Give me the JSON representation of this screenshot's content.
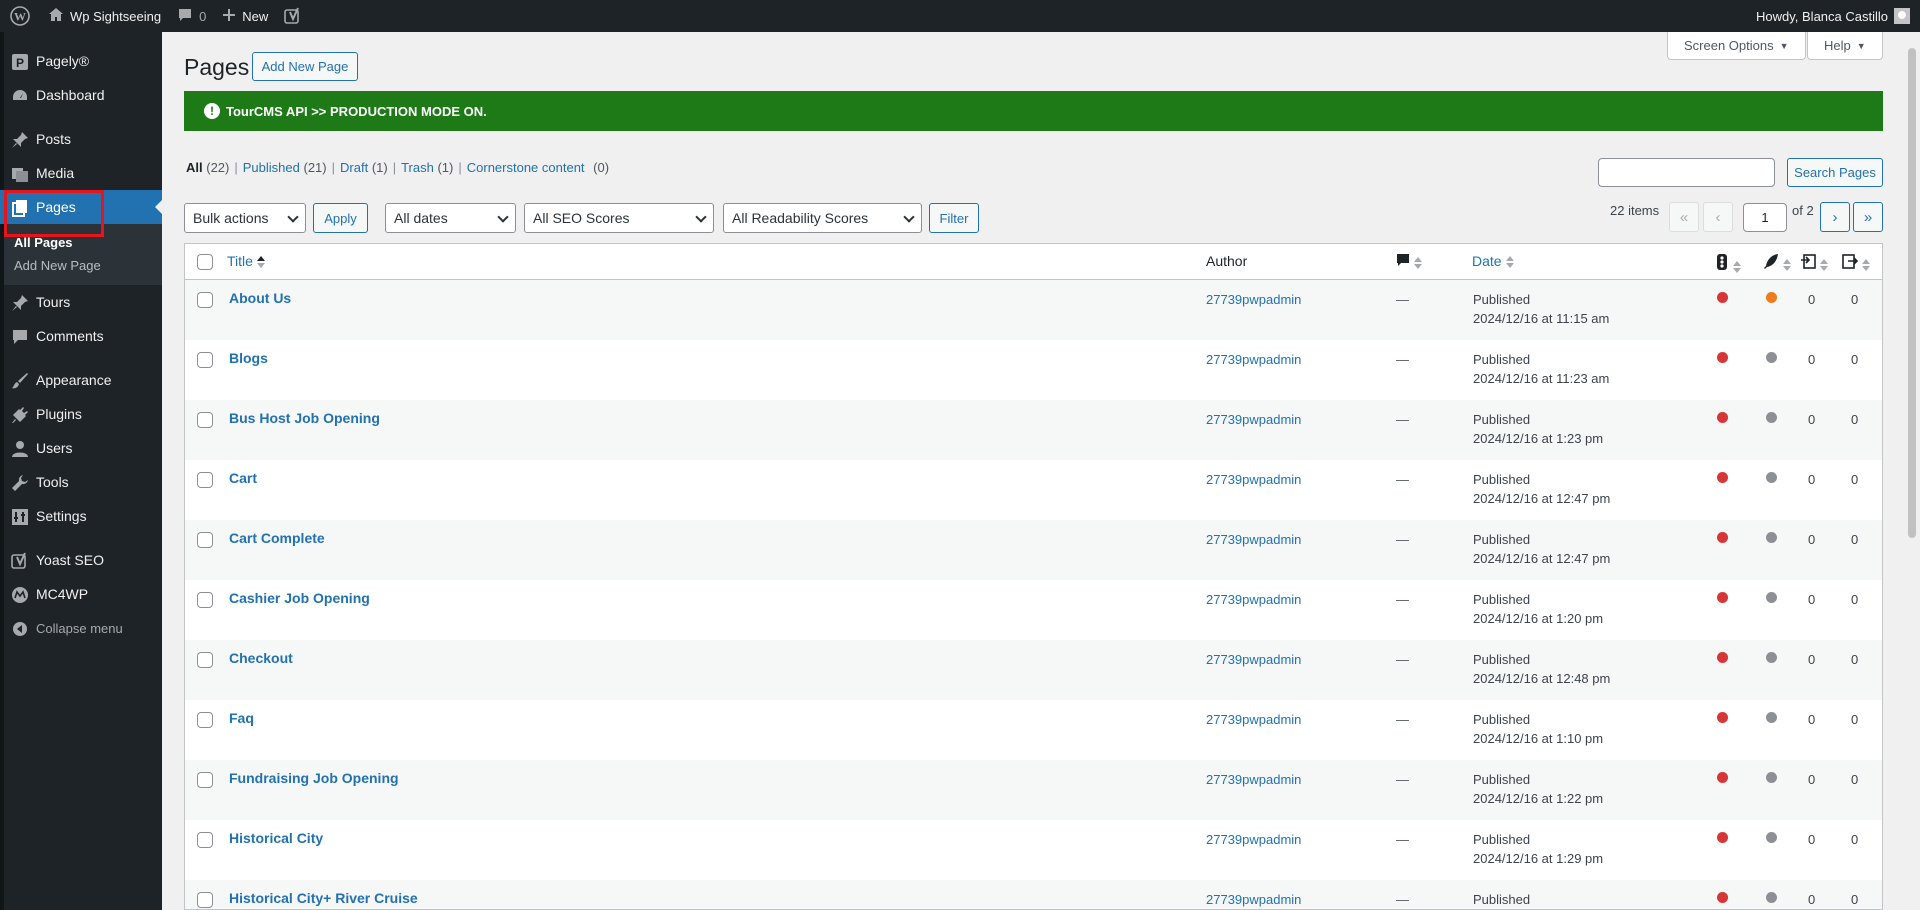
{
  "adminbar": {
    "site_name": "Wp Sightseeing",
    "comments_count": "0",
    "new_label": "New",
    "howdy": "Howdy, Blanca Castillo"
  },
  "sidebar": {
    "items": [
      {
        "label": "Pagely®",
        "icon": "pagely-icon"
      },
      {
        "label": "Dashboard",
        "icon": "dashboard-icon"
      },
      {
        "label": "Posts",
        "icon": "pin-icon"
      },
      {
        "label": "Media",
        "icon": "media-icon"
      },
      {
        "label": "Pages",
        "icon": "pages-icon"
      },
      {
        "label": "Tours",
        "icon": "pin-icon"
      },
      {
        "label": "Comments",
        "icon": "comment-icon"
      },
      {
        "label": "Appearance",
        "icon": "brush-icon"
      },
      {
        "label": "Plugins",
        "icon": "plug-icon"
      },
      {
        "label": "Users",
        "icon": "user-icon"
      },
      {
        "label": "Tools",
        "icon": "wrench-icon"
      },
      {
        "label": "Settings",
        "icon": "settings-icon"
      },
      {
        "label": "Yoast SEO",
        "icon": "yoast-icon"
      },
      {
        "label": "MC4WP",
        "icon": "mc4wp-icon"
      },
      {
        "label": "Collapse menu",
        "icon": "collapse-icon"
      }
    ],
    "submenu": [
      "All Pages",
      "Add New Page"
    ]
  },
  "header": {
    "title": "Pages",
    "add_new": "Add New Page",
    "screen_options": "Screen Options",
    "help": "Help"
  },
  "notice": "TourCMS API >> PRODUCTION MODE ON.",
  "views": [
    {
      "label": "All",
      "count": "(22)"
    },
    {
      "label": "Published",
      "count": "(21)"
    },
    {
      "label": "Draft",
      "count": "(1)"
    },
    {
      "label": "Trash",
      "count": "(1)"
    },
    {
      "label": "Cornerstone content",
      "count": "(0)"
    }
  ],
  "search": {
    "button": "Search Pages",
    "value": ""
  },
  "filters": {
    "bulk": "Bulk actions",
    "apply": "Apply",
    "dates": "All dates",
    "seo": "All SEO Scores",
    "readability": "All Readability Scores",
    "filter": "Filter"
  },
  "pagination": {
    "items": "22 items",
    "first": "«",
    "prev": "‹",
    "current": "1",
    "of": "of 2",
    "next": "›",
    "last": "»"
  },
  "table": {
    "headers": {
      "title": "Title",
      "author": "Author",
      "comments": "comment-icon",
      "date": "Date"
    },
    "colors": {
      "red": "#d63638",
      "orange": "#ee7c1b",
      "gray": "#8c8f94"
    },
    "rows": [
      {
        "title": "About Us",
        "author": "27739pwpadmin",
        "comments": "—",
        "status": "Published",
        "date": "2024/12/16 at 11:15 am",
        "seo": "red",
        "read": "orange",
        "links_in": "0",
        "links_out": "0"
      },
      {
        "title": "Blogs",
        "author": "27739pwpadmin",
        "comments": "—",
        "status": "Published",
        "date": "2024/12/16 at 11:23 am",
        "seo": "red",
        "read": "gray",
        "links_in": "0",
        "links_out": "0"
      },
      {
        "title": "Bus Host Job Opening",
        "author": "27739pwpadmin",
        "comments": "—",
        "status": "Published",
        "date": "2024/12/16 at 1:23 pm",
        "seo": "red",
        "read": "gray",
        "links_in": "0",
        "links_out": "0"
      },
      {
        "title": "Cart",
        "author": "27739pwpadmin",
        "comments": "—",
        "status": "Published",
        "date": "2024/12/16 at 12:47 pm",
        "seo": "red",
        "read": "gray",
        "links_in": "0",
        "links_out": "0"
      },
      {
        "title": "Cart Complete",
        "author": "27739pwpadmin",
        "comments": "—",
        "status": "Published",
        "date": "2024/12/16 at 12:47 pm",
        "seo": "red",
        "read": "gray",
        "links_in": "0",
        "links_out": "0"
      },
      {
        "title": "Cashier Job Opening",
        "author": "27739pwpadmin",
        "comments": "—",
        "status": "Published",
        "date": "2024/12/16 at 1:20 pm",
        "seo": "red",
        "read": "gray",
        "links_in": "0",
        "links_out": "0"
      },
      {
        "title": "Checkout",
        "author": "27739pwpadmin",
        "comments": "—",
        "status": "Published",
        "date": "2024/12/16 at 12:48 pm",
        "seo": "red",
        "read": "gray",
        "links_in": "0",
        "links_out": "0"
      },
      {
        "title": "Faq",
        "author": "27739pwpadmin",
        "comments": "—",
        "status": "Published",
        "date": "2024/12/16 at 1:10 pm",
        "seo": "red",
        "read": "gray",
        "links_in": "0",
        "links_out": "0"
      },
      {
        "title": "Fundraising Job Opening",
        "author": "27739pwpadmin",
        "comments": "—",
        "status": "Published",
        "date": "2024/12/16 at 1:22 pm",
        "seo": "red",
        "read": "gray",
        "links_in": "0",
        "links_out": "0"
      },
      {
        "title": "Historical City",
        "author": "27739pwpadmin",
        "comments": "—",
        "status": "Published",
        "date": "2024/12/16 at 1:29 pm",
        "seo": "red",
        "read": "gray",
        "links_in": "0",
        "links_out": "0"
      },
      {
        "title": "Historical City+ River Cruise",
        "author": "27739pwpadmin",
        "comments": "—",
        "status": "Published",
        "date": "",
        "seo": "red",
        "read": "gray",
        "links_in": "0",
        "links_out": "0"
      }
    ]
  }
}
